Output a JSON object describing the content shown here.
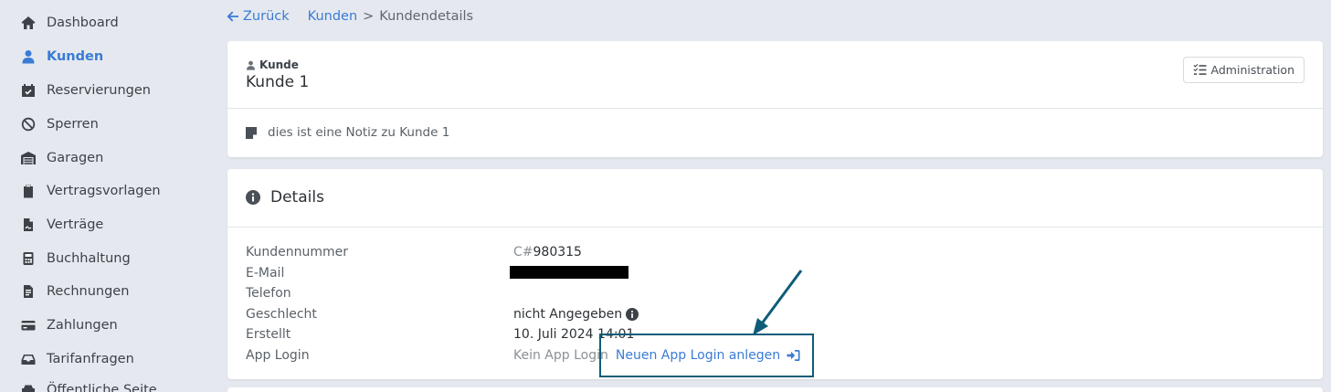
{
  "sidebar": {
    "items": [
      {
        "label": "Dashboard",
        "icon": "home-icon",
        "active": false
      },
      {
        "label": "Kunden",
        "icon": "user-icon",
        "active": true
      },
      {
        "label": "Reservierungen",
        "icon": "calendar-check-icon",
        "active": false
      },
      {
        "label": "Sperren",
        "icon": "ban-icon",
        "active": false
      },
      {
        "label": "Garagen",
        "icon": "warehouse-icon",
        "active": false
      },
      {
        "label": "Vertragsvorlagen",
        "icon": "clipboard-icon",
        "active": false
      },
      {
        "label": "Verträge",
        "icon": "file-signature-icon",
        "active": false
      },
      {
        "label": "Buchhaltung",
        "icon": "calculator-icon",
        "active": false
      },
      {
        "label": "Rechnungen",
        "icon": "file-invoice-icon",
        "active": false
      },
      {
        "label": "Zahlungen",
        "icon": "credit-card-icon",
        "active": false
      },
      {
        "label": "Tarifanfragen",
        "icon": "inbox-icon",
        "active": false
      },
      {
        "label": "Öffentliche Seite",
        "icon": "car-icon",
        "active": false
      }
    ]
  },
  "breadcrumb": {
    "back": "Zurück",
    "parent": "Kunden",
    "separator": ">",
    "current": "Kundendetails"
  },
  "customer": {
    "section_label": "Kunde",
    "name": "Kunde 1",
    "admin_button": "Administration",
    "note": "dies ist eine Notiz zu Kunde 1"
  },
  "details": {
    "title": "Details",
    "labels": {
      "customer_number": "Kundennummer",
      "email": "E-Mail",
      "phone": "Telefon",
      "gender": "Geschlecht",
      "created": "Erstellt",
      "app_login": "App Login"
    },
    "values": {
      "customer_number_prefix": "C#",
      "customer_number": "980315",
      "phone": "",
      "gender": "nicht Angegeben",
      "created": "10. Juli 2024 14:01",
      "app_login_status": "Kein App Login",
      "app_login_action": "Neuen App Login anlegen"
    }
  },
  "colors": {
    "accent": "#3a7bd5",
    "background": "#e5e9ef",
    "annotation": "#0e5c79"
  }
}
